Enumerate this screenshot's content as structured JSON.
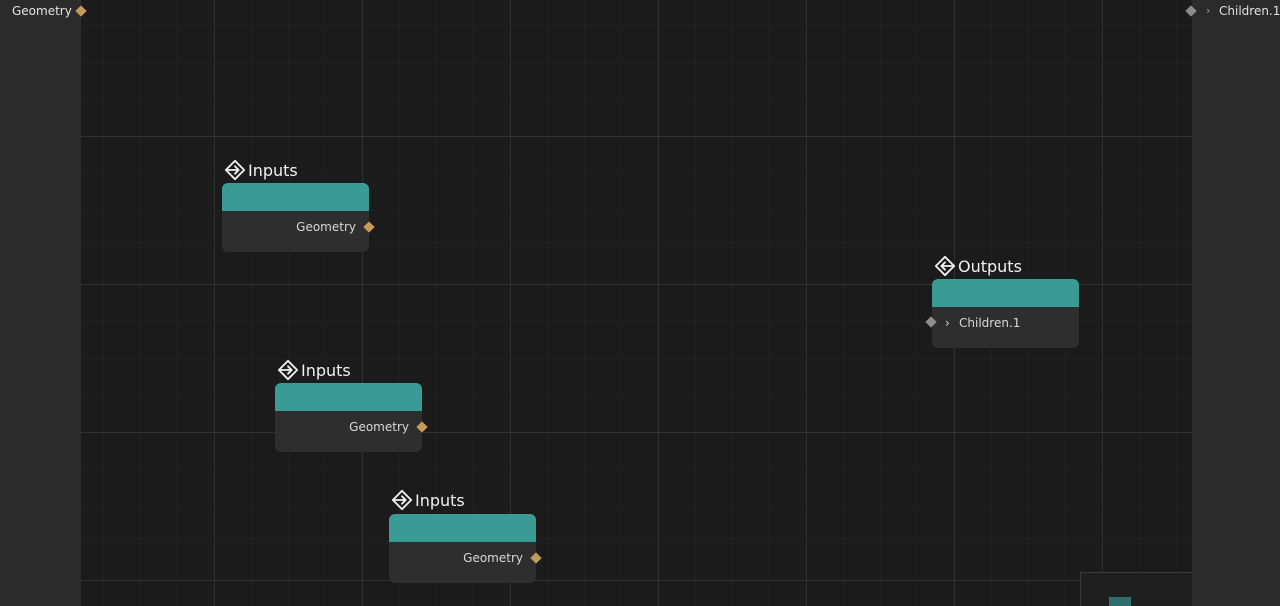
{
  "graph_inputs": {
    "label": "Geometry"
  },
  "graph_outputs": {
    "label": "Children.1",
    "chevron": "›"
  },
  "nodes": [
    {
      "kind": "input",
      "title": "Inputs",
      "port_label": "Geometry"
    },
    {
      "kind": "input",
      "title": "Inputs",
      "port_label": "Geometry"
    },
    {
      "kind": "input",
      "title": "Inputs",
      "port_label": "Geometry"
    },
    {
      "kind": "output",
      "title": "Outputs",
      "port_label": "Children.1",
      "chevron": "›"
    }
  ],
  "colors": {
    "node_header": "#3a9a94",
    "geometry_port": "#c69a5b",
    "untyped_port": "#8d8d8d"
  },
  "icons": {
    "input_node": "arrow-into-diamond-icon",
    "output_node": "arrow-out-of-diamond-icon"
  }
}
